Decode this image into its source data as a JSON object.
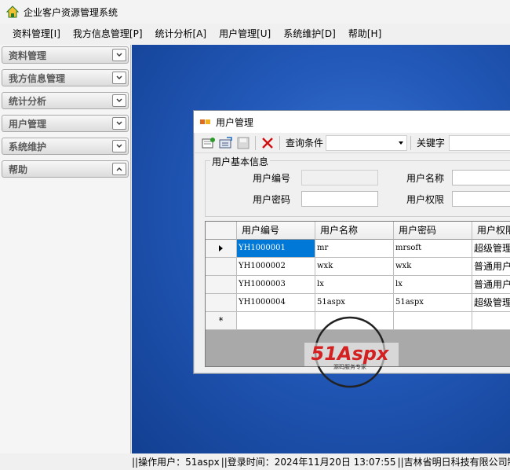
{
  "app": {
    "title": "企业客户资源管理系统"
  },
  "menu": [
    "资料管理[I]",
    "我方信息管理[P]",
    "统计分析[A]",
    "用户管理[U]",
    "系统维护[D]",
    "帮助[H]"
  ],
  "sidebar": {
    "items": [
      {
        "label": "资料管理",
        "state": "collapsed"
      },
      {
        "label": "我方信息管理",
        "state": "collapsed"
      },
      {
        "label": "统计分析",
        "state": "collapsed"
      },
      {
        "label": "用户管理",
        "state": "collapsed"
      },
      {
        "label": "系统维护",
        "state": "collapsed"
      },
      {
        "label": "帮助",
        "state": "expanded"
      }
    ]
  },
  "window": {
    "title": "用户管理",
    "toolbar": {
      "icons": [
        "add-icon",
        "edit-icon",
        "save-icon",
        "delete-icon"
      ],
      "query_label": "查询条件",
      "query_value": "",
      "keyword_label": "关键字",
      "keyword_value": ""
    },
    "group": {
      "legend": "用户基本信息",
      "id_label": "用户编号",
      "id_value": "",
      "name_label": "用户名称",
      "name_value": "",
      "password_label": "用户密码",
      "password_value": "",
      "permission_label": "用户权限",
      "permission_value": ""
    },
    "grid": {
      "columns": [
        "用户编号",
        "用户名称",
        "用户密码",
        "用户权限"
      ],
      "rows": [
        [
          "YH1000001",
          "mr",
          "mrsoft",
          "超级管理员"
        ],
        [
          "YH1000002",
          "wxk",
          "wxk",
          "普通用户"
        ],
        [
          "YH1000003",
          "lx",
          "lx",
          "普通用户"
        ],
        [
          "YH1000004",
          "51aspx",
          "51aspx",
          "超级管理员"
        ]
      ],
      "selected_row": 0,
      "new_row_marker": "*"
    }
  },
  "watermark": {
    "brand": "51Aspx",
    "tagline": "源码服务专家"
  },
  "status": {
    "operator": "||操作用户：51aspx",
    "login_time": "||登录时间：2024年11月20日 13:07:55",
    "company": "||吉林省明日科技有限公司制作"
  },
  "colors": {
    "desktop": "#2258b8",
    "selection": "#0078d7",
    "delete_icon": "#d01010"
  }
}
